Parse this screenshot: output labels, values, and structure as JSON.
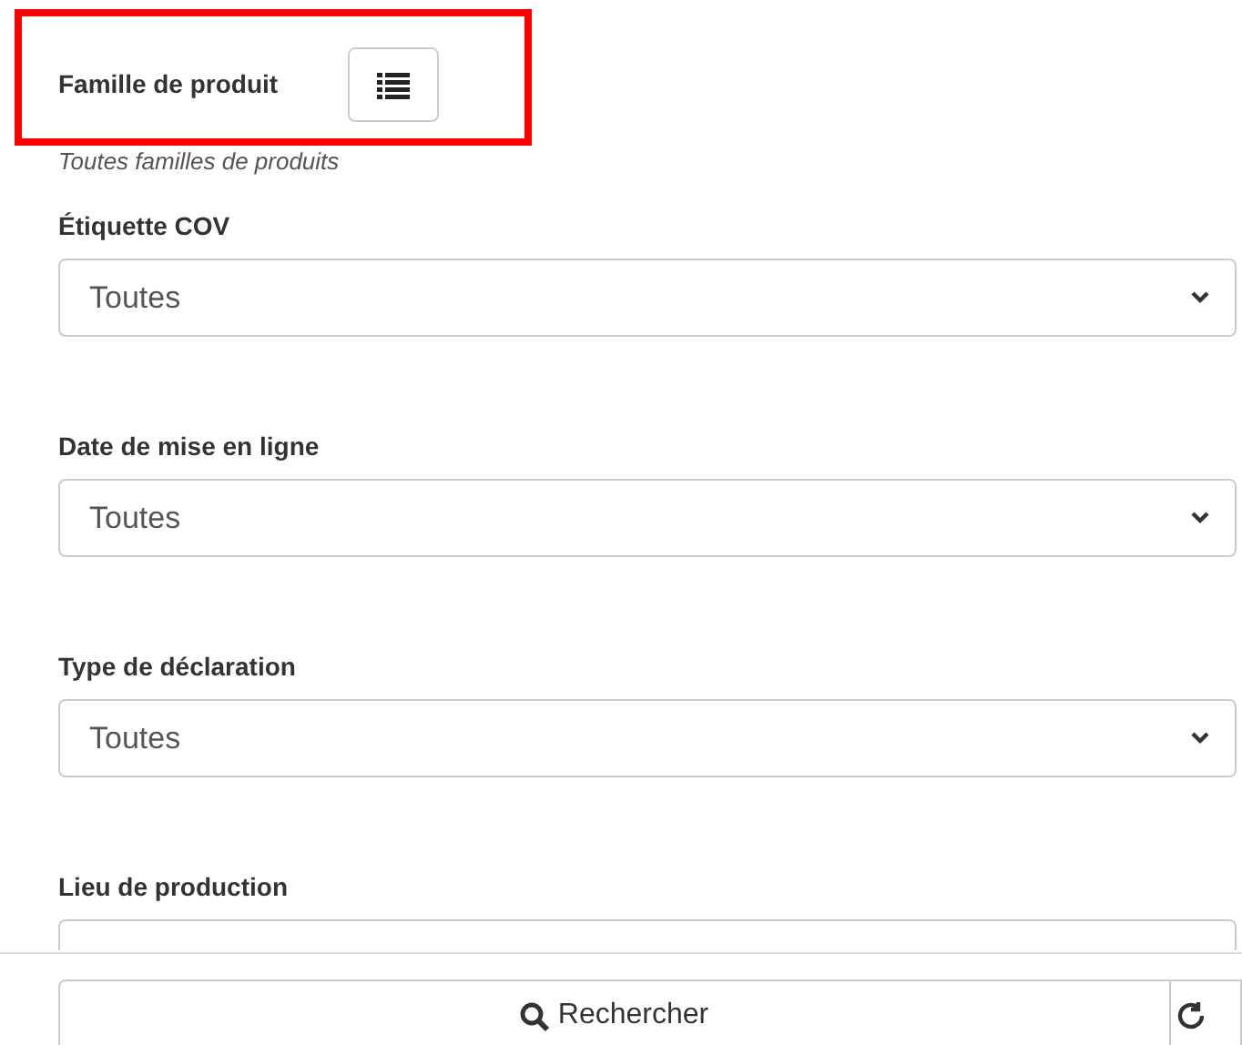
{
  "family_filter": {
    "label": "Famille de produit",
    "hint": "Toutes familles de produits"
  },
  "filters": [
    {
      "label": "Étiquette COV",
      "value": "Toutes"
    },
    {
      "label": "Date de mise en ligne",
      "value": "Toutes"
    },
    {
      "label": "Type de déclaration",
      "value": "Toutes"
    },
    {
      "label": "Lieu de production"
    }
  ],
  "search_button": {
    "label": "Rechercher"
  }
}
